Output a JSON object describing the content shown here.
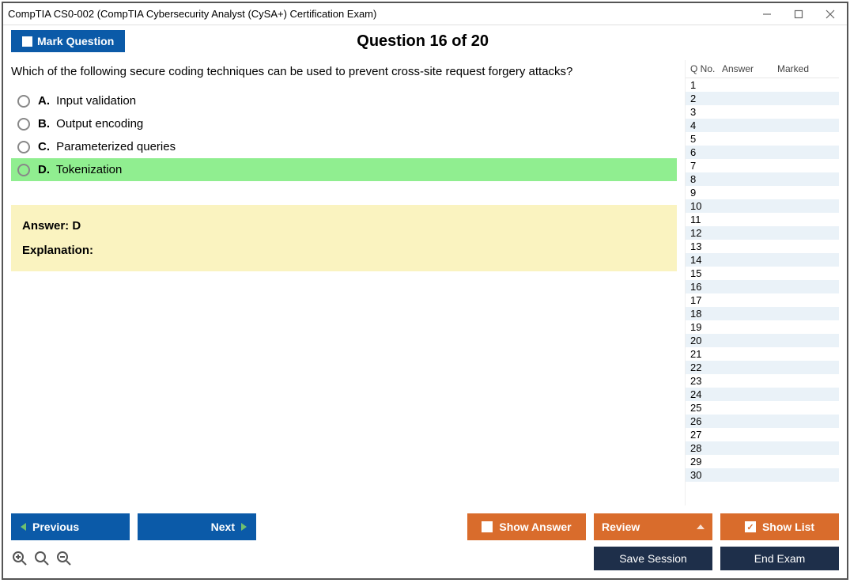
{
  "window": {
    "title": "CompTIA CS0-002 (CompTIA Cybersecurity Analyst (CySA+) Certification Exam)"
  },
  "toolbar": {
    "mark_label": "Mark Question",
    "question_title": "Question 16 of 20"
  },
  "question": {
    "text": "Which of the following secure coding techniques can be used to prevent cross-site request forgery attacks?",
    "options": [
      {
        "letter": "A.",
        "text": "Input validation",
        "correct": false
      },
      {
        "letter": "B.",
        "text": "Output encoding",
        "correct": false
      },
      {
        "letter": "C.",
        "text": "Parameterized queries",
        "correct": false
      },
      {
        "letter": "D.",
        "text": "Tokenization",
        "correct": true
      }
    ]
  },
  "answer_box": {
    "answer_label": "Answer: D",
    "explanation_label": "Explanation:"
  },
  "side": {
    "headers": {
      "qno": "Q No.",
      "answer": "Answer",
      "marked": "Marked"
    },
    "rows": [
      {
        "n": "1"
      },
      {
        "n": "2"
      },
      {
        "n": "3"
      },
      {
        "n": "4"
      },
      {
        "n": "5"
      },
      {
        "n": "6"
      },
      {
        "n": "7"
      },
      {
        "n": "8"
      },
      {
        "n": "9"
      },
      {
        "n": "10"
      },
      {
        "n": "11"
      },
      {
        "n": "12"
      },
      {
        "n": "13"
      },
      {
        "n": "14"
      },
      {
        "n": "15"
      },
      {
        "n": "16"
      },
      {
        "n": "17"
      },
      {
        "n": "18"
      },
      {
        "n": "19"
      },
      {
        "n": "20"
      },
      {
        "n": "21"
      },
      {
        "n": "22"
      },
      {
        "n": "23"
      },
      {
        "n": "24"
      },
      {
        "n": "25"
      },
      {
        "n": "26"
      },
      {
        "n": "27"
      },
      {
        "n": "28"
      },
      {
        "n": "29"
      },
      {
        "n": "30"
      }
    ]
  },
  "buttons": {
    "previous": "Previous",
    "next": "Next",
    "show_answer": "Show Answer",
    "review": "Review",
    "show_list": "Show List",
    "save_session": "Save Session",
    "end_exam": "End Exam"
  }
}
